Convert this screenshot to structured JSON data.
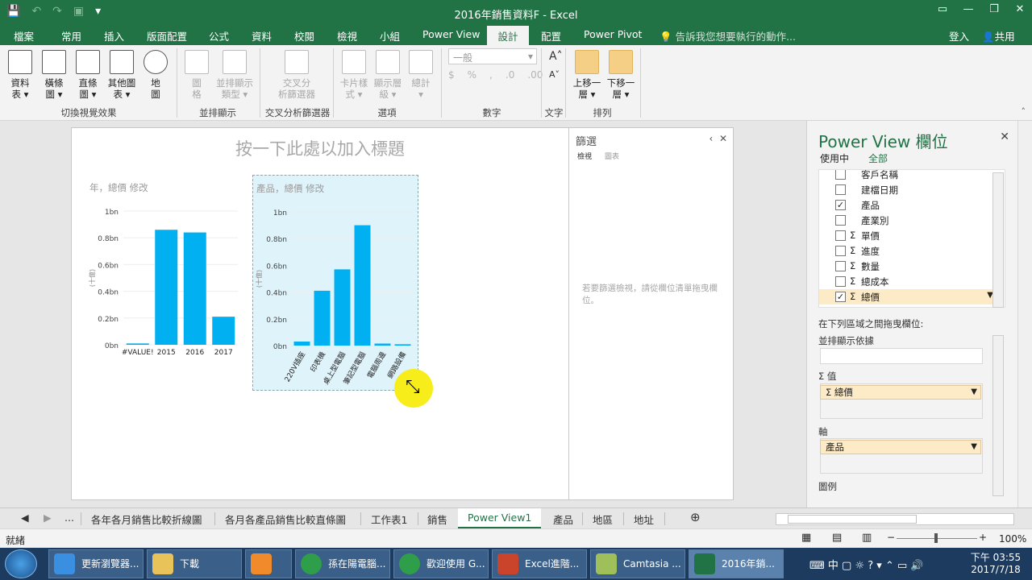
{
  "window": {
    "title": "2016年銷售資料F - Excel"
  },
  "account": {
    "signin": "登入",
    "share": "共用"
  },
  "tabs": [
    "檔案",
    "常用",
    "插入",
    "版面配置",
    "公式",
    "資料",
    "校閱",
    "檢視",
    "小組",
    "Power View",
    "設計",
    "配置",
    "Power Pivot"
  ],
  "active_tab": "設計",
  "tellme": "告訴我您想要執行的動作...",
  "ribbon": {
    "buttons": [
      {
        "label1": "資料",
        "label2": "表 ▾"
      },
      {
        "label1": "橫條",
        "label2": "圖 ▾"
      },
      {
        "label1": "直條",
        "label2": "圖 ▾"
      },
      {
        "label1": "其他圖",
        "label2": "表 ▾"
      },
      {
        "label1": "地",
        "label2": "圖"
      },
      {
        "label1": "圖",
        "label2": "格"
      },
      {
        "label1": "並排顯示",
        "label2": "類型 ▾"
      },
      {
        "label1": "交叉分",
        "label2": "析篩選器"
      },
      {
        "label1": "卡片樣",
        "label2": "式 ▾"
      },
      {
        "label1": "顯示層",
        "label2": "級 ▾"
      },
      {
        "label1": "總計",
        "label2": "▾"
      },
      {
        "label1": "上移一",
        "label2": "層 ▾"
      },
      {
        "label1": "下移一",
        "label2": "層 ▾"
      }
    ],
    "groups": [
      "切換視覺效果",
      "並排顯示",
      "交叉分析篩選器",
      "選項",
      "數字",
      "文字",
      "排列"
    ],
    "number_format": "一般"
  },
  "canvas": {
    "title_placeholder": "按一下此處以加入標題"
  },
  "chart_data": [
    {
      "type": "bar",
      "title": "年，總價 修改",
      "categories": [
        "#VALUE!",
        "2015",
        "2016",
        "2017"
      ],
      "values": [
        0.01,
        0.86,
        0.84,
        0.21
      ],
      "ylabel": "(十億)",
      "yticks": [
        "0bn",
        "0.2bn",
        "0.4bn",
        "0.6bn",
        "0.8bn",
        "1bn"
      ],
      "ylim": [
        0,
        1
      ],
      "color": "#00b0f0"
    },
    {
      "type": "bar",
      "title": "產品，總價 修改",
      "categories": [
        "220V插座",
        "印表機",
        "桌上型電腦",
        "筆記型電腦",
        "電腦周邊",
        "網路設備"
      ],
      "values": [
        0.03,
        0.41,
        0.57,
        0.9,
        0.015,
        0.01
      ],
      "ylabel": "(十億)",
      "yticks": [
        "0bn",
        "0.2bn",
        "0.4bn",
        "0.6bn",
        "0.8bn",
        "1bn"
      ],
      "ylim": [
        0,
        1
      ],
      "color": "#00b0f0"
    }
  ],
  "filter": {
    "title": "篩選",
    "tab_view": "檢視",
    "tab_chart": "圖表",
    "hint": "若要篩選檢視，請從欄位清單拖曳欄位。"
  },
  "fields_panel": {
    "title": "Power View 欄位",
    "tab_active": "使用中",
    "tab_all": "全部",
    "fields": [
      {
        "name": "客戶名稱",
        "sigma": false,
        "checked": false
      },
      {
        "name": "建檔日期",
        "sigma": false,
        "checked": false
      },
      {
        "name": "產品",
        "sigma": false,
        "checked": true
      },
      {
        "name": "產業別",
        "sigma": false,
        "checked": false
      },
      {
        "name": "單價",
        "sigma": true,
        "checked": false
      },
      {
        "name": "進度",
        "sigma": true,
        "checked": false
      },
      {
        "name": "數量",
        "sigma": true,
        "checked": false
      },
      {
        "name": "總成本",
        "sigma": true,
        "checked": false
      },
      {
        "name": "總價",
        "sigma": true,
        "checked": true
      }
    ],
    "drag_hint": "在下列區域之間拖曳欄位:",
    "tile_by": "並排顯示依據",
    "values_label": "Σ 值",
    "values_pill": "Σ 總價",
    "axis_label": "軸",
    "axis_pill": "產品",
    "legend_label": "圖例"
  },
  "sheets": [
    "...",
    "各年各月銷售比較折線圖",
    "各月各產品銷售比較直條圖",
    "工作表1",
    "銷售",
    "Power View1",
    "產品",
    "地區",
    "地址"
  ],
  "active_sheet": "Power View1",
  "status": {
    "ready": "就緒",
    "zoom": "100%"
  },
  "taskbar": {
    "buttons": [
      "更新瀏覽器...",
      "下載",
      "",
      "孫在陽電腦...",
      "歡迎使用 G...",
      "Excel進階...",
      "Camtasia ...",
      "2016年銷..."
    ],
    "time": "下午 03:55",
    "date": "2017/7/18",
    "ime": "中"
  }
}
